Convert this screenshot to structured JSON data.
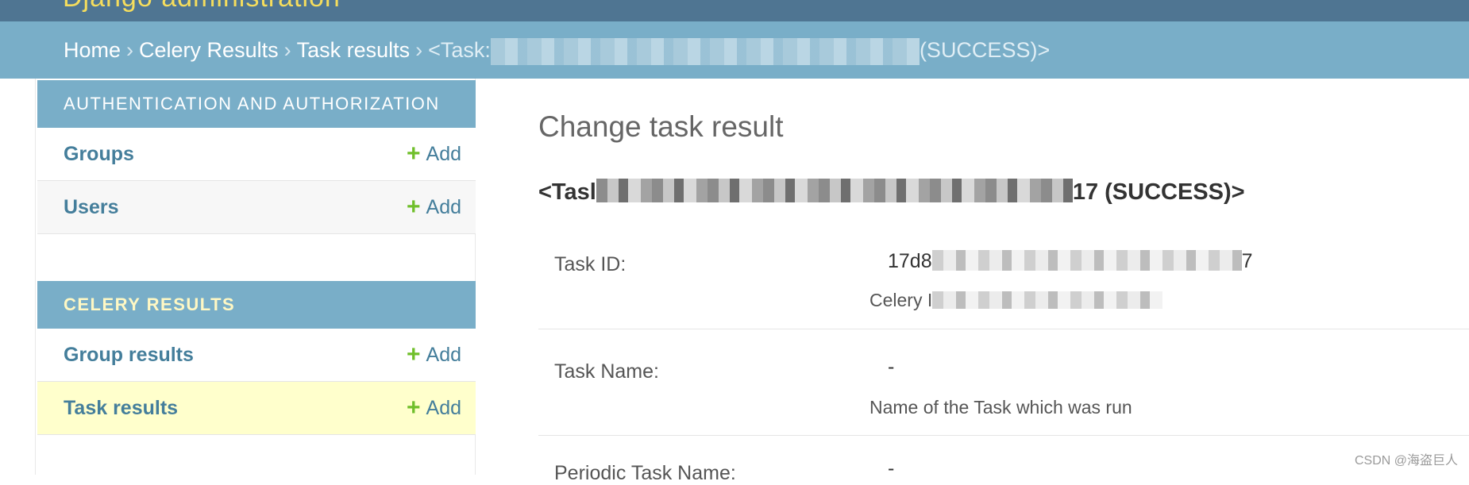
{
  "header": {
    "brand": "Django administration"
  },
  "breadcrumbs": {
    "home": "Home",
    "app": "Celery Results",
    "model": "Task results",
    "separator": "›",
    "current_prefix": "<Task:",
    "current_suffix": "(SUCCESS)>"
  },
  "sidebar": {
    "modules": [
      {
        "caption": "AUTHENTICATION AND AUTHORIZATION",
        "items": [
          {
            "label": "Groups",
            "add": "Add"
          },
          {
            "label": "Users",
            "add": "Add"
          }
        ]
      },
      {
        "caption": "CELERY RESULTS",
        "items": [
          {
            "label": "Group results",
            "add": "Add"
          },
          {
            "label": "Task results",
            "add": "Add"
          }
        ]
      }
    ]
  },
  "content": {
    "title": "Change task result",
    "object_heading_prefix": "<Tasl",
    "object_heading_suffix": "17 (SUCCESS)>",
    "fields": [
      {
        "label": "Task ID:",
        "value_prefix": "17d8",
        "value_suffix": "7",
        "help_prefix": "Celery I"
      },
      {
        "label": "Task Name:",
        "value": "-",
        "help": "Name of the Task which was run"
      },
      {
        "label": "Periodic Task Name:",
        "value": "-"
      }
    ]
  },
  "watermark": "CSDN @海盗巨人",
  "colors": {
    "header": "#4f7592",
    "breadcrumbs": "#79aec8",
    "link": "#447e9b",
    "add_icon": "#70bf2b",
    "selected_row": "#ffffcc",
    "caption_highlight": "#fff8c4"
  }
}
